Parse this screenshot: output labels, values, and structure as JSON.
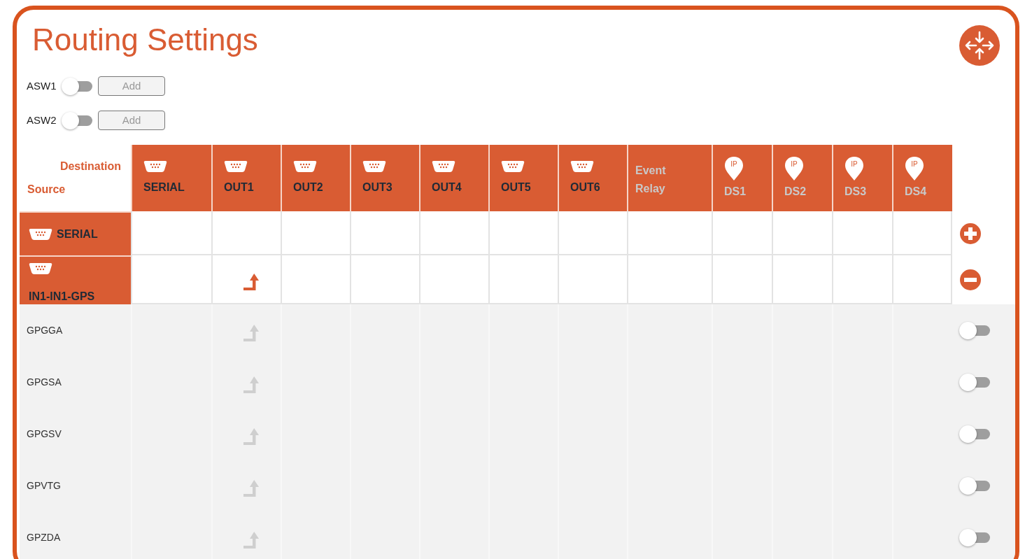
{
  "title": "Routing Settings",
  "switches": [
    {
      "label": "ASW1",
      "on": false,
      "button": "Add",
      "button_disabled": true
    },
    {
      "label": "ASW2",
      "on": false,
      "button": "Add",
      "button_disabled": true
    }
  ],
  "corner": {
    "destination": "Destination",
    "source": "Source"
  },
  "columns": [
    {
      "kind": "serial",
      "label": "SERIAL",
      "disabled": false
    },
    {
      "kind": "serial",
      "label": "OUT1",
      "disabled": false
    },
    {
      "kind": "serial",
      "label": "OUT2",
      "disabled": false
    },
    {
      "kind": "serial",
      "label": "OUT3",
      "disabled": false
    },
    {
      "kind": "serial",
      "label": "OUT4",
      "disabled": false
    },
    {
      "kind": "serial",
      "label": "OUT5",
      "disabled": false
    },
    {
      "kind": "serial",
      "label": "OUT6",
      "disabled": false
    },
    {
      "kind": "relay",
      "label": "Event Relay",
      "disabled": true
    },
    {
      "kind": "ip",
      "label": "DS1",
      "badge": "IP",
      "disabled": true
    },
    {
      "kind": "ip",
      "label": "DS2",
      "badge": "IP",
      "disabled": true
    },
    {
      "kind": "ip",
      "label": "DS3",
      "badge": "IP",
      "disabled": true
    },
    {
      "kind": "ip",
      "label": "DS4",
      "badge": "IP",
      "disabled": true
    }
  ],
  "sources": [
    {
      "label": "SERIAL",
      "kind": "add",
      "routes": [
        false,
        false,
        false,
        false,
        false,
        false,
        false,
        false,
        false,
        false,
        false,
        false
      ]
    },
    {
      "label": "IN1-IN1-GPS",
      "kind": "remove",
      "routes": [
        false,
        true,
        false,
        false,
        false,
        false,
        false,
        false,
        false,
        false,
        false,
        false
      ],
      "messages": [
        {
          "label": "GPGGA",
          "on": false,
          "routes": [
            false,
            true,
            false,
            false,
            false,
            false,
            false,
            false,
            false,
            false,
            false,
            false
          ]
        },
        {
          "label": "GPGSA",
          "on": false,
          "routes": [
            false,
            true,
            false,
            false,
            false,
            false,
            false,
            false,
            false,
            false,
            false,
            false
          ]
        },
        {
          "label": "GPGSV",
          "on": false,
          "routes": [
            false,
            true,
            false,
            false,
            false,
            false,
            false,
            false,
            false,
            false,
            false,
            false
          ]
        },
        {
          "label": "GPVTG",
          "on": false,
          "routes": [
            false,
            true,
            false,
            false,
            false,
            false,
            false,
            false,
            false,
            false,
            false,
            false
          ]
        },
        {
          "label": "GPZDA",
          "on": false,
          "routes": [
            false,
            true,
            false,
            false,
            false,
            false,
            false,
            false,
            false,
            false,
            false,
            false
          ]
        }
      ]
    }
  ]
}
